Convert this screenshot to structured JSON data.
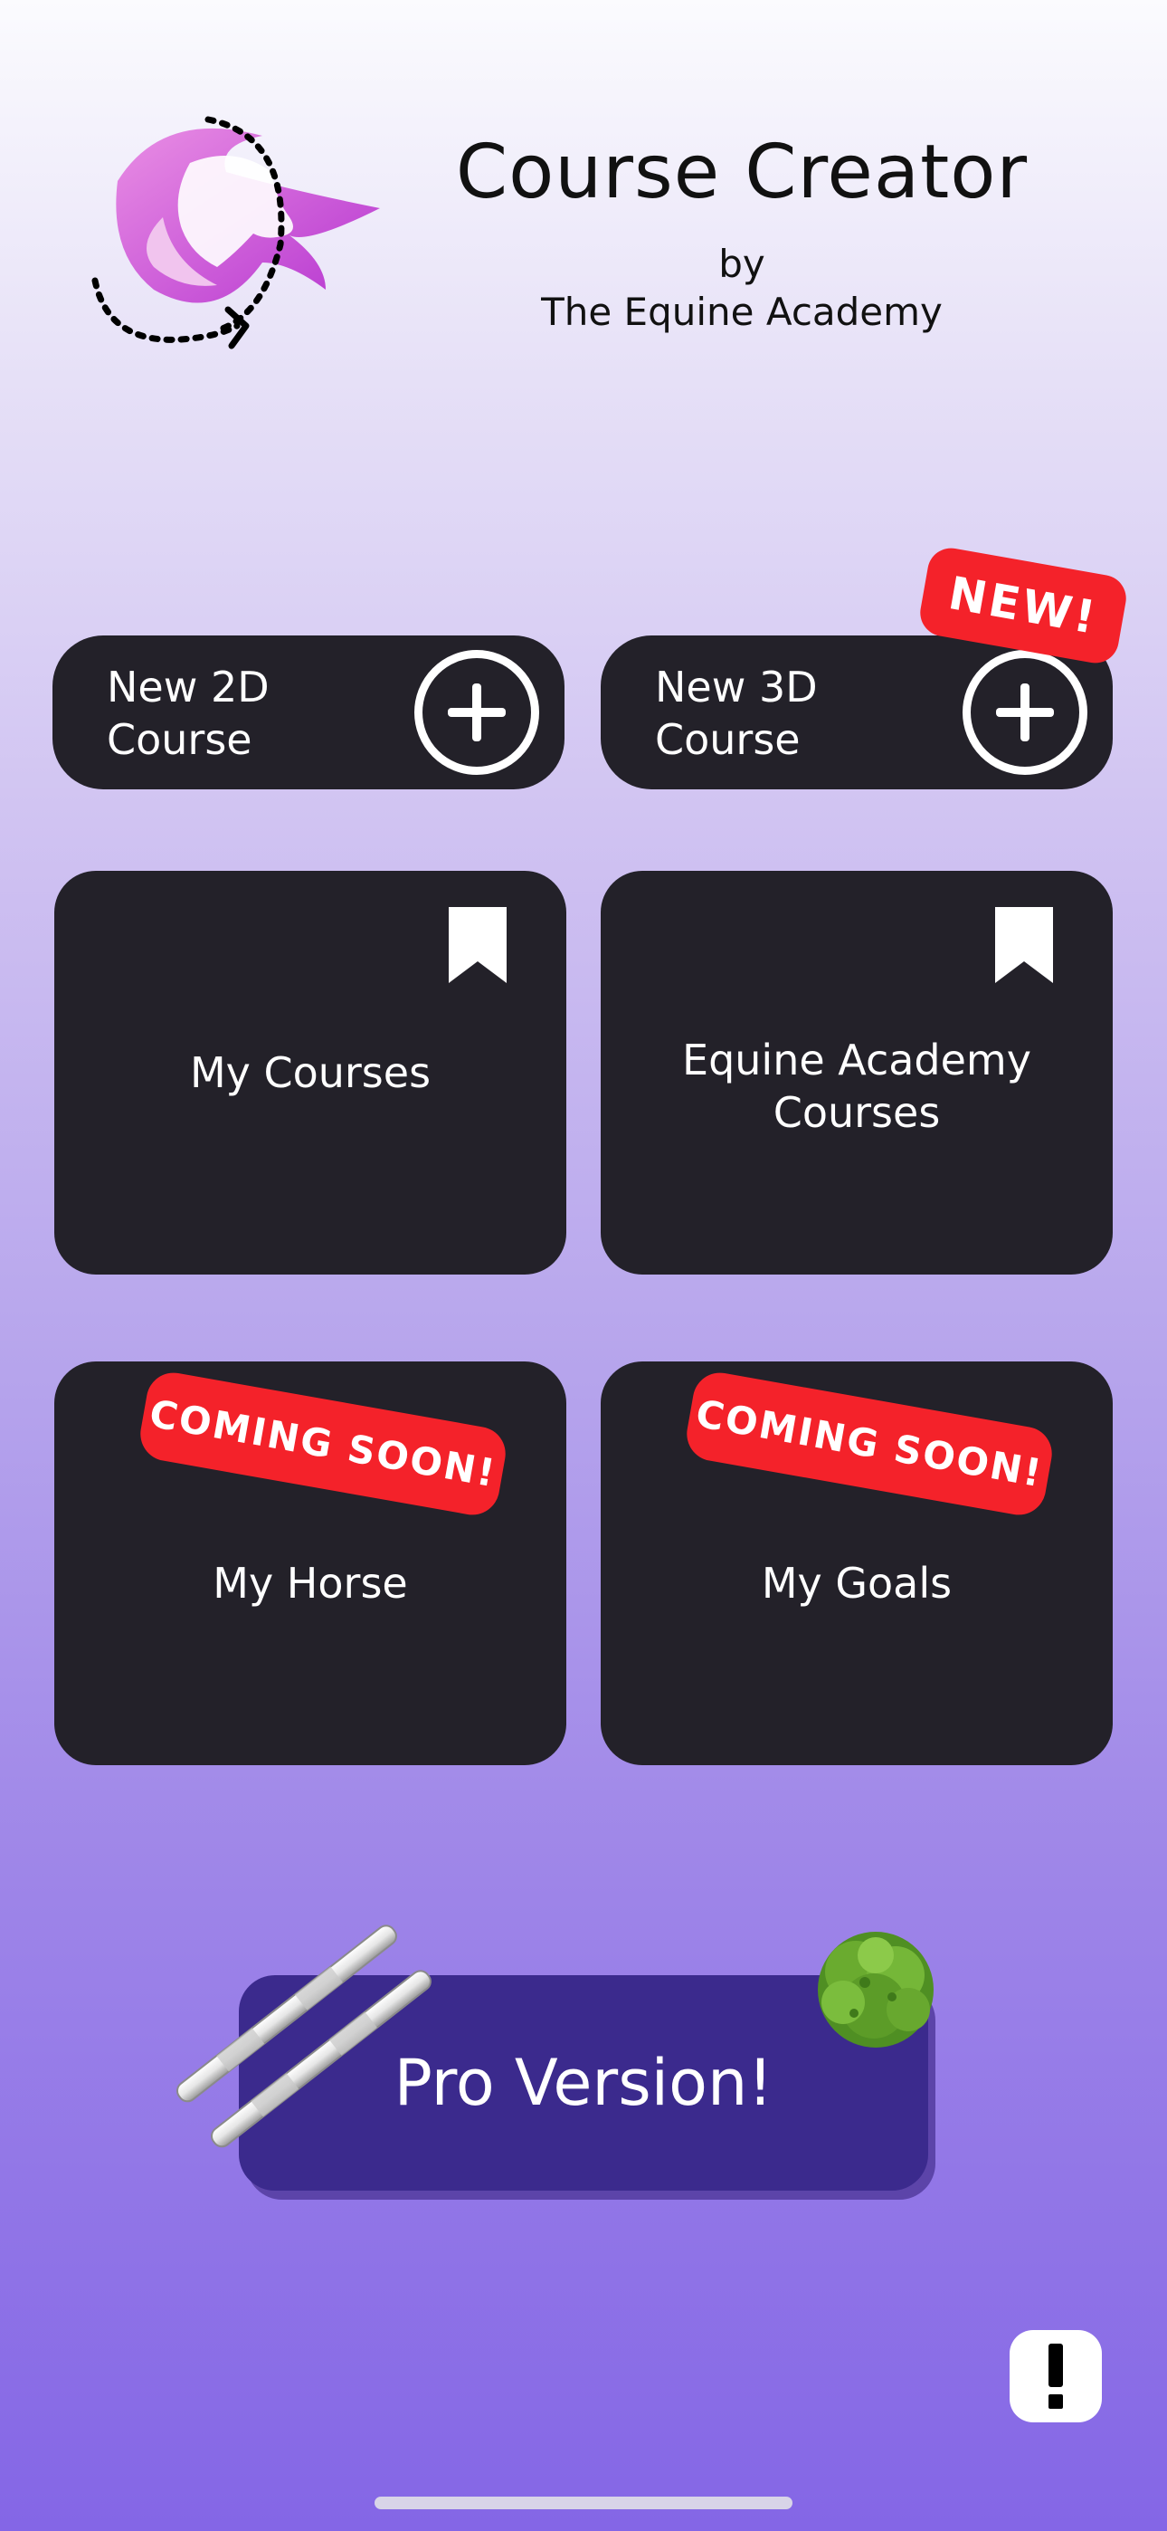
{
  "header": {
    "title": "Course Creator",
    "by": "by",
    "org": "The Equine Academy"
  },
  "create_buttons": [
    {
      "label": "New 2D\nCourse",
      "icon": "plus-circle-icon"
    },
    {
      "label": "New 3D\nCourse",
      "icon": "plus-circle-icon"
    }
  ],
  "badges": {
    "new": "NEW!",
    "coming_soon": "COMING SOON!"
  },
  "cards": [
    {
      "label": "My Courses",
      "icon": "bookmark-icon"
    },
    {
      "label": "Equine Academy Courses",
      "icon": "bookmark-icon"
    },
    {
      "label": "My Horse"
    },
    {
      "label": "My Goals"
    }
  ],
  "pro": {
    "label": "Pro Version!"
  },
  "info": {
    "icon": "exclamation-icon",
    "glyph": "!"
  },
  "colors": {
    "card": "#232129",
    "badge_red": "#f4222a",
    "pro_purple": "#3b2a8d",
    "logo_magenta": "#d74fd6"
  }
}
